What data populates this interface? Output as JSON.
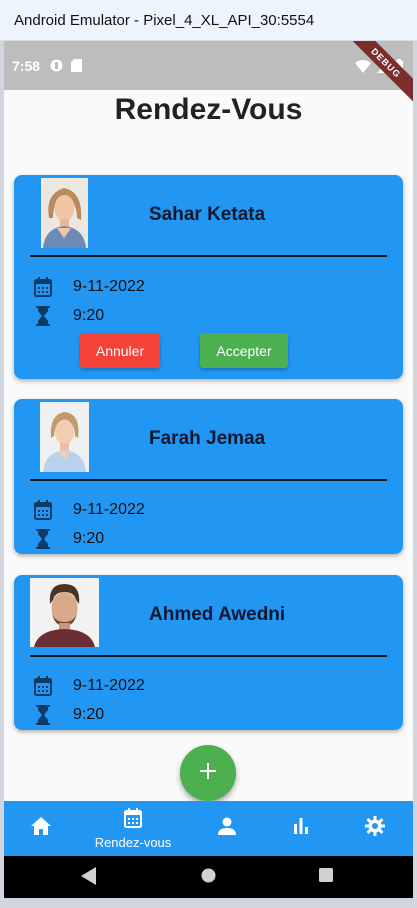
{
  "window": {
    "title": "Android Emulator - Pixel_4_XL_API_30:5554"
  },
  "statusbar": {
    "time": "7:58",
    "debug_label": "DEBUG"
  },
  "page": {
    "title": "Rendez-Vous"
  },
  "appointments": [
    {
      "name": "Sahar Ketata",
      "date": "9-11-2022",
      "time": "9:20",
      "cancel_label": "Annuler",
      "accept_label": "Accepter"
    },
    {
      "name": "Farah Jemaa",
      "date": "9-11-2022",
      "time": "9:20"
    },
    {
      "name": "Ahmed Awedni",
      "date": "9-11-2022",
      "time": "9:20"
    }
  ],
  "fab": {
    "icon": "plus-icon"
  },
  "bottom_nav": {
    "items": [
      {
        "icon": "home-icon"
      },
      {
        "icon": "calendar-icon",
        "label": "Rendez-vous"
      },
      {
        "icon": "person-icon"
      },
      {
        "icon": "bar-chart-icon"
      },
      {
        "icon": "settings-icon"
      }
    ]
  },
  "colors": {
    "primary": "#2196f3",
    "cancel": "#f44336",
    "accept": "#4caf50",
    "statusbar": "#bdbdbd"
  }
}
